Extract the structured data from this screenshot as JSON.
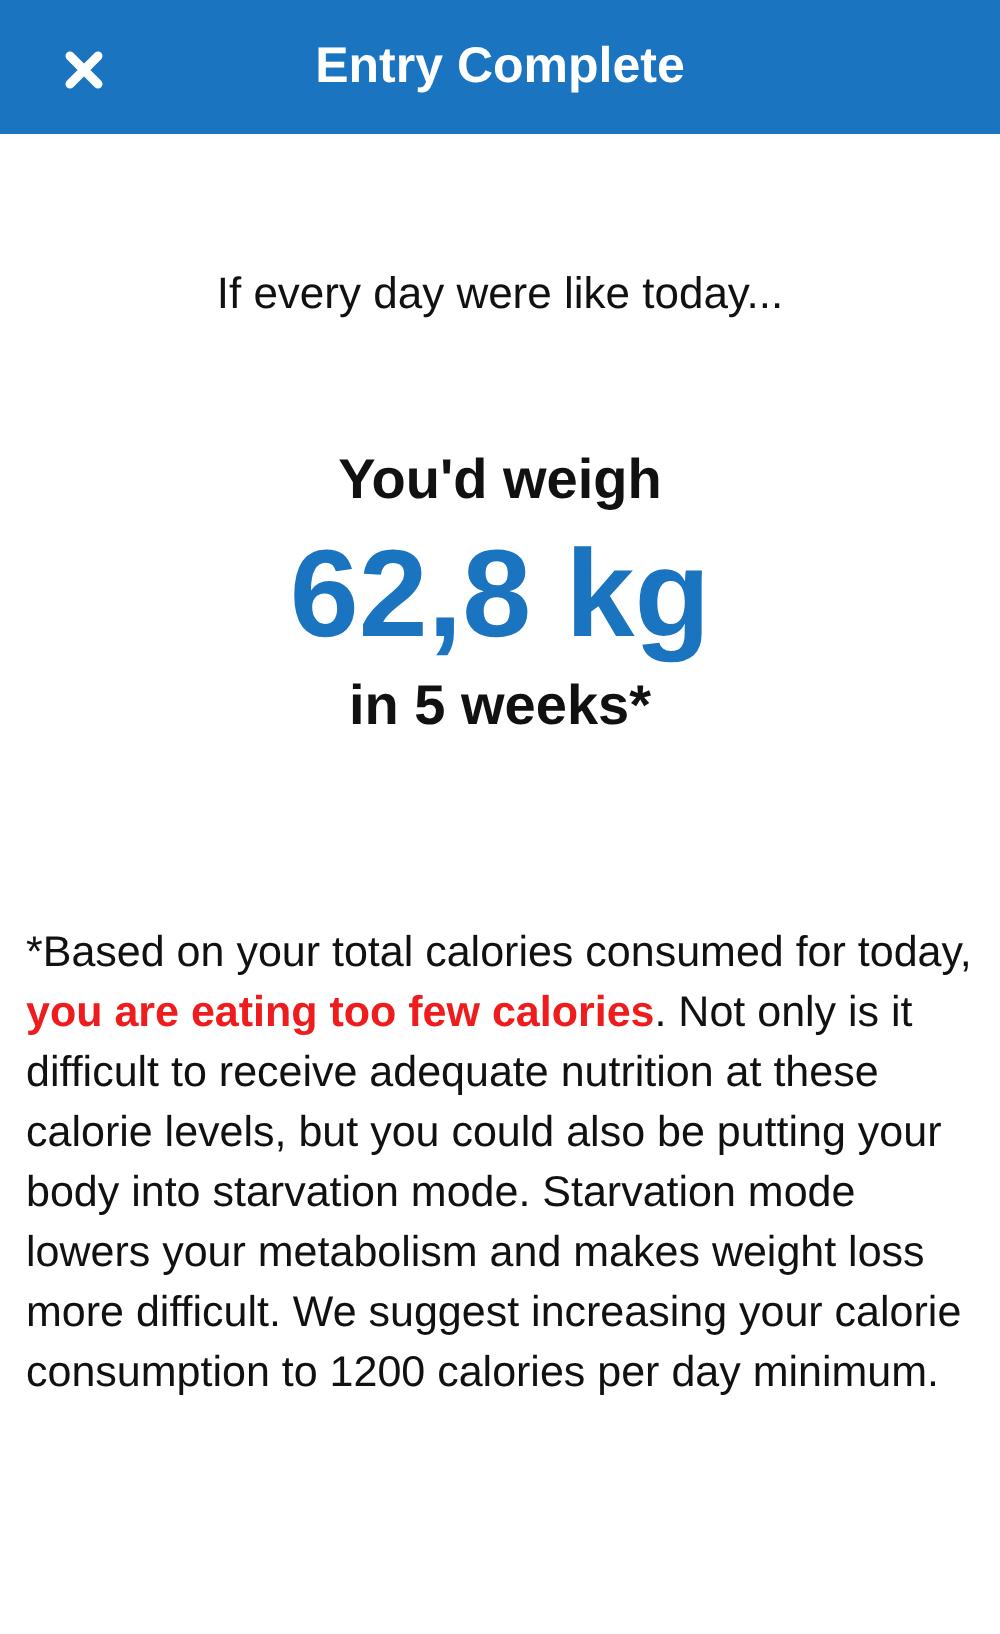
{
  "header": {
    "title": "Entry Complete"
  },
  "intro": "If every day were like today...",
  "result": {
    "lead": "You'd weigh",
    "weight": "62,8 kg",
    "period": "in 5 weeks*"
  },
  "note": "*Based on your total calories consumed for today, **you are eating too few calories**. Not only is it difficult to receive adequate nutrition at these calorie levels, but you could also be putting your body into starvation mode. Starvation mode lowers your metabolism and makes weight loss more difficult. We suggest increasing your calorie consumption to 1200 calories per day minimum."
}
